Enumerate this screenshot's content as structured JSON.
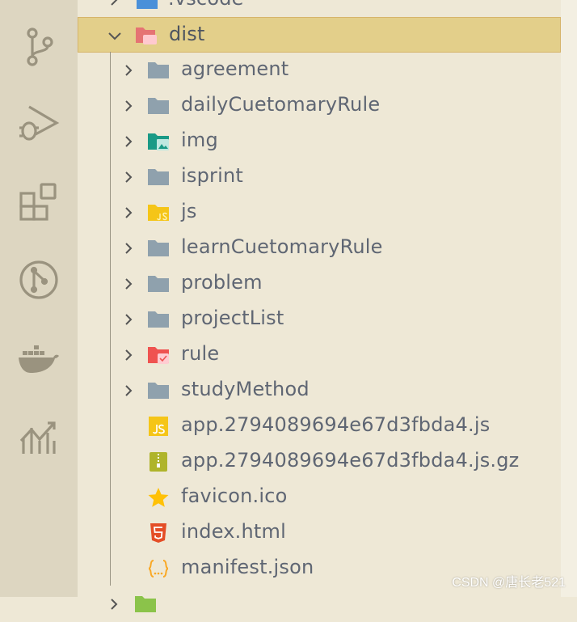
{
  "activity_bar": {
    "icons": [
      "source-control-icon",
      "run-debug-icon",
      "extensions-icon",
      "git-graph-icon",
      "docker-icon",
      "analytics-icon"
    ]
  },
  "explorer": {
    "partial_top_label": ".vscode",
    "selected_folder": "dist",
    "folders": [
      {
        "label": "agreement"
      },
      {
        "label": "dailyCuetomaryRule"
      },
      {
        "label": "img"
      },
      {
        "label": "isprint"
      },
      {
        "label": "js"
      },
      {
        "label": "learnCuetomaryRule"
      },
      {
        "label": "problem"
      },
      {
        "label": "projectList"
      },
      {
        "label": "rule"
      },
      {
        "label": "studyMethod"
      }
    ],
    "files": [
      {
        "label": "app.2794089694e67d3fbda4.js"
      },
      {
        "label": "app.2794089694e67d3fbda4.js.gz"
      },
      {
        "label": "favicon.ico"
      },
      {
        "label": "index.html"
      },
      {
        "label": "manifest.json"
      }
    ]
  },
  "colors": {
    "selection": "#e3cf8a",
    "sidebar_bg": "#eee8d6",
    "activity_bg": "#ddd6c1",
    "folder_grey": "#8fa1ad",
    "js_yellow": "#f5c518",
    "html_orange": "#e44d26"
  },
  "watermark": "CSDN @唐长老521"
}
